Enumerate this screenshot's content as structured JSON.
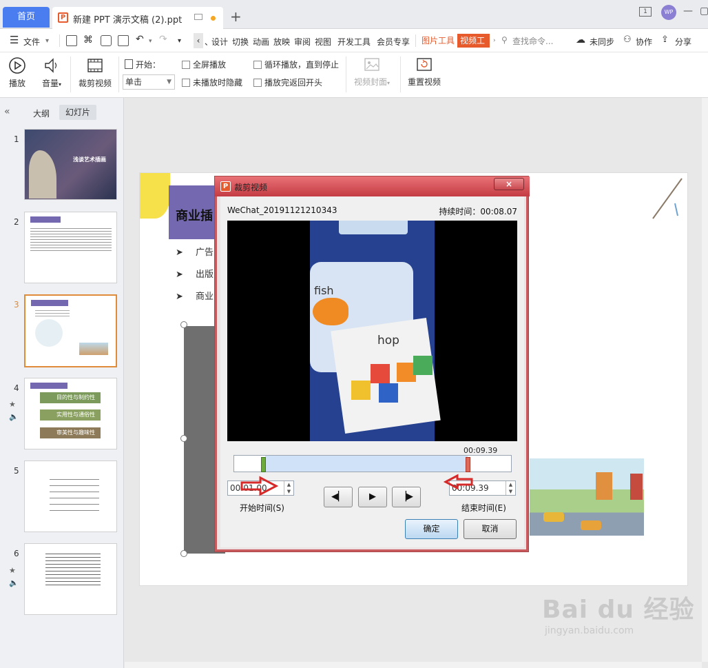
{
  "tabs": {
    "home": "首页",
    "document": "新建 PPT 演示文稿 (2).ppt",
    "add": "+"
  },
  "menubar": {
    "file": "文件",
    "items": [
      "设计",
      "切换",
      "动画",
      "放映",
      "审阅",
      "视图",
      "开发工具",
      "会员专享"
    ],
    "picture_tools": "图片工具",
    "video_tools": "视频工具",
    "search_placeholder": "查找命令...",
    "sync": "未同步",
    "collab": "协作",
    "share": "分享",
    "avatar": "WP"
  },
  "ribbon": {
    "play": "播放",
    "volume": "音量",
    "trim": "裁剪视频",
    "start_label": "开始：",
    "start_value": "单击",
    "fullscreen": "全屏播放",
    "hide_not_playing": "未播放时隐藏",
    "loop": "循环播放，直到停止",
    "rewind": "播放完返回开头",
    "cover": "视频封面",
    "reset": "重置视频"
  },
  "left_panel": {
    "outline": "大纲",
    "slides": "幻灯片",
    "slide_numbers": [
      "1",
      "2",
      "3",
      "4",
      "5",
      "6"
    ],
    "slide1_title": "浅谈艺术插画",
    "slide4_items": [
      "目的性与制约性",
      "实用性与通俗性",
      "审美性与趣味性"
    ]
  },
  "slide_content": {
    "title": "商业插",
    "bullets": [
      "广告",
      "出版",
      "商业"
    ]
  },
  "dialog": {
    "title": "裁剪视频",
    "close": "×",
    "file_name": "WeChat_20191121210343",
    "duration": "持续时间：00:08.07",
    "end_marker": "00:09.39",
    "start_time_value": "00:01.00",
    "end_time_value": "00:09.39",
    "start_time_label": "开始时间(S)",
    "end_time_label": "结束时间(E)",
    "ok": "确定",
    "cancel": "取消",
    "video_text_fish": "fish",
    "video_text_hop": "hop"
  },
  "watermark": {
    "brand": "Bai du 经验",
    "url": "jingyan.baidu.com"
  },
  "colors": {
    "accent_blue": "#4a7ef0",
    "picture_tools": "#e65a2c",
    "video_tools": "#e65a2c",
    "dialog_red": "#c43c43"
  }
}
